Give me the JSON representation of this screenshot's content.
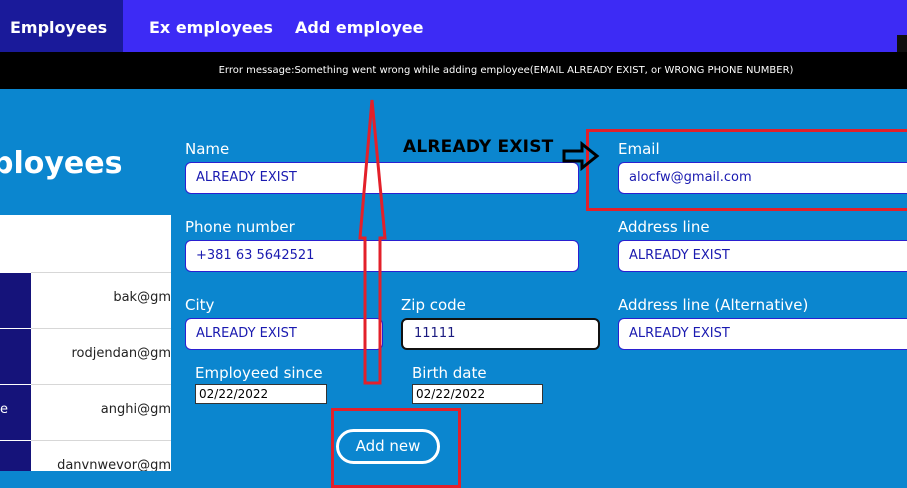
{
  "nav": {
    "items": [
      "Employees",
      "Ex employees",
      "Add employee"
    ]
  },
  "error": {
    "message": "Error message:Something went wrong while adding employee(EMAIL ALREADY EXIST, or WRONG PHONE NUMBER)"
  },
  "background": {
    "title": "ployees",
    "rows": [
      {
        "email": "bak@gm"
      },
      {
        "email": "rodjendan@gm"
      },
      {
        "email": "anghi@gm",
        "prefix": "e"
      },
      {
        "email": "danvnwevor@gm"
      }
    ]
  },
  "annotation": {
    "note": "ALREADY EXIST"
  },
  "form": {
    "name_label": "Name",
    "name_value": "ALREADY EXIST",
    "email_label": "Email",
    "email_value": "alocfw@gmail.com",
    "phone_label": "Phone number",
    "phone_value": "+381 63 5642521",
    "address_label": "Address line",
    "address_value": "ALREADY EXIST",
    "city_label": "City",
    "city_value": "ALREADY EXIST",
    "zip_label": "Zip code",
    "zip_value": "11111",
    "address_alt_label": "Address line (Alternative)",
    "address_alt_value": "ALREADY EXIST",
    "employed_label": "Employeed since",
    "employed_value": "02/22/2022",
    "birth_label": "Birth date",
    "birth_value": "02/22/2022",
    "submit_label": "Add new"
  },
  "colors": {
    "nav": "#3d2bf5",
    "nav_active": "#1a1a9a",
    "page": "#0b86cf",
    "annotation_red": "#e3202a"
  }
}
